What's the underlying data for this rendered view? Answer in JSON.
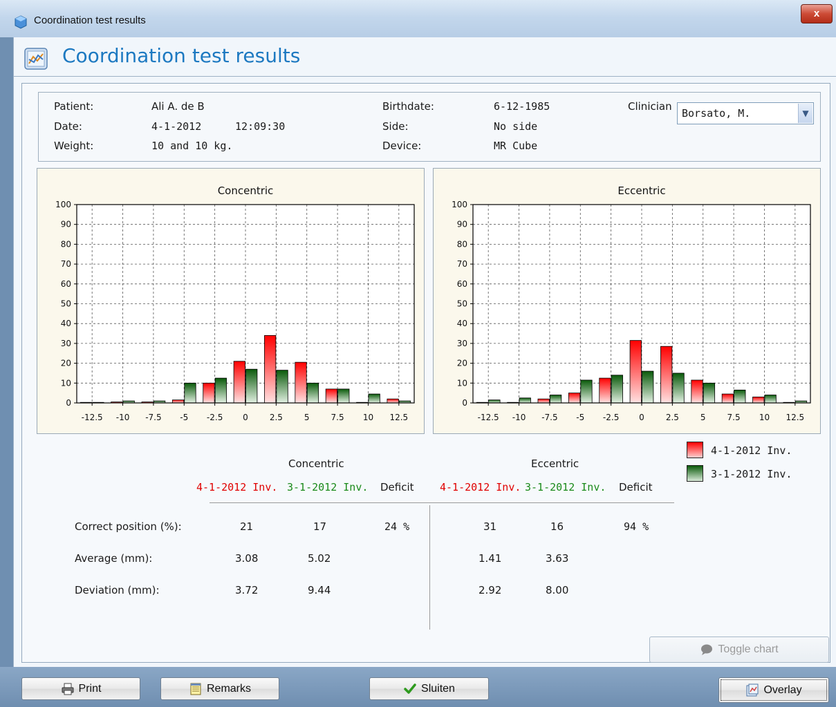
{
  "window": {
    "title": "Coordination test results",
    "close_label": "x"
  },
  "header": {
    "title": "Coordination test results"
  },
  "info": {
    "patient_label": "Patient:",
    "patient_value": "Ali A. de B",
    "date_label": "Date:",
    "date_value": "4-1-2012",
    "time_value": "12:09:30",
    "weight_label": "Weight:",
    "weight_value": "10 and 10 kg.",
    "birthdate_label": "Birthdate:",
    "birthdate_value": "6-12-1985",
    "side_label": "Side:",
    "side_value": "No side",
    "device_label": "Device:",
    "device_value": "MR Cube",
    "clinician_label": "Clinician",
    "clinician_value": "Borsato, M."
  },
  "colors": {
    "series_a": "#ff0000",
    "series_b": "#0a5a0a",
    "title_blue": "#1d79c1"
  },
  "chart_data": [
    {
      "type": "bar",
      "title": "Concentric",
      "categories": [
        "-12.5",
        "-10",
        "-7.5",
        "-5",
        "-2.5",
        "0",
        "2.5",
        "5",
        "7.5",
        "10",
        "12.5"
      ],
      "series": [
        {
          "name": "4-1-2012 Inv.",
          "values": [
            0,
            0.5,
            0.5,
            1.5,
            10,
            21,
            34,
            20.5,
            7,
            0,
            2
          ]
        },
        {
          "name": "3-1-2012 Inv.",
          "values": [
            0,
            1,
            1,
            10,
            12.5,
            17,
            16.5,
            10,
            7,
            4.5,
            1
          ]
        }
      ],
      "ylim": [
        0,
        100
      ],
      "yticks": [
        "0",
        "10",
        "20",
        "30",
        "40",
        "50",
        "60",
        "70",
        "80",
        "90",
        "100"
      ],
      "grid": true
    },
    {
      "type": "bar",
      "title": "Eccentric",
      "categories": [
        "-12.5",
        "-10",
        "-7.5",
        "-5",
        "-2.5",
        "0",
        "2.5",
        "5",
        "7.5",
        "10",
        "12.5"
      ],
      "series": [
        {
          "name": "4-1-2012 Inv.",
          "values": [
            0,
            0,
            2,
            5,
            12.5,
            31.5,
            28.5,
            11.5,
            4.5,
            3,
            0
          ]
        },
        {
          "name": "3-1-2012 Inv.",
          "values": [
            1.5,
            2.5,
            4,
            11.5,
            14,
            16,
            15,
            10,
            6.5,
            4,
            1
          ]
        }
      ],
      "ylim": [
        0,
        100
      ],
      "yticks": [
        "0",
        "10",
        "20",
        "30",
        "40",
        "50",
        "60",
        "70",
        "80",
        "90",
        "100"
      ],
      "grid": true
    }
  ],
  "legend": [
    {
      "label": "4-1-2012 Inv."
    },
    {
      "label": "3-1-2012 Inv."
    }
  ],
  "results": {
    "concentric_title": "Concentric",
    "eccentric_title": "Eccentric",
    "col_a": "4-1-2012 Inv.",
    "col_b": "3-1-2012 Inv.",
    "col_deficit": "Deficit",
    "rows": [
      {
        "label": "Correct position (%):",
        "con_a": "21",
        "con_b": "17",
        "con_def": "24 %",
        "ecc_a": "31",
        "ecc_b": "16",
        "ecc_def": "94 %"
      },
      {
        "label": "Average (mm):",
        "con_a": "3.08",
        "con_b": "5.02",
        "con_def": "",
        "ecc_a": "1.41",
        "ecc_b": "3.63",
        "ecc_def": ""
      },
      {
        "label": "Deviation (mm):",
        "con_a": "3.72",
        "con_b": "9.44",
        "con_def": "",
        "ecc_a": "2.92",
        "ecc_b": "8.00",
        "ecc_def": ""
      }
    ]
  },
  "buttons": {
    "toggle_chart": "Toggle chart",
    "print": "Print",
    "remarks": "Remarks",
    "close": "Sluiten",
    "overlay": "Overlay"
  }
}
